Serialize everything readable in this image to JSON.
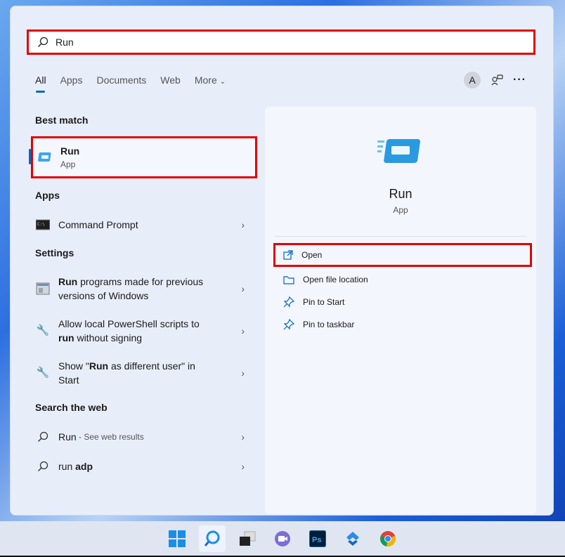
{
  "search": {
    "query": "Run"
  },
  "tabs": [
    {
      "label": "All"
    },
    {
      "label": "Apps"
    },
    {
      "label": "Documents"
    },
    {
      "label": "Web"
    },
    {
      "label": "More"
    }
  ],
  "account": {
    "initial": "A"
  },
  "sections": {
    "best_match": "Best match",
    "apps": "Apps",
    "settings": "Settings",
    "web": "Search the web"
  },
  "best": {
    "title": "Run",
    "subtitle": "App"
  },
  "apps": [
    {
      "label": "Command Prompt"
    }
  ],
  "settings": [
    {
      "l1": [
        {
          "t": "Run",
          "b": true
        },
        {
          "t": " programs made for previous",
          "b": false
        }
      ],
      "l2": [
        {
          "t": "versions of Windows",
          "b": false
        }
      ]
    },
    {
      "l1": [
        {
          "t": "Allow local PowerShell scripts to",
          "b": false
        }
      ],
      "l2": [
        {
          "t": "run",
          "b": true
        },
        {
          "t": " without signing",
          "b": false
        }
      ]
    },
    {
      "l1": [
        {
          "t": "Show \"",
          "b": false
        },
        {
          "t": "Run",
          "b": true
        },
        {
          "t": " as different user\" in",
          "b": false
        }
      ],
      "l2": [
        {
          "t": "Start",
          "b": false
        }
      ]
    }
  ],
  "web": [
    {
      "main": "Run",
      "suffix": " - See web results"
    },
    {
      "main": "run ",
      "bold": "adp"
    }
  ],
  "detail": {
    "title": "Run",
    "subtitle": "App",
    "actions": [
      {
        "label": "Open"
      },
      {
        "label": "Open file location"
      },
      {
        "label": "Pin to Start"
      },
      {
        "label": "Pin to taskbar"
      }
    ]
  },
  "colors": {
    "accent": "#0067c0",
    "highlight": "#e00000"
  }
}
